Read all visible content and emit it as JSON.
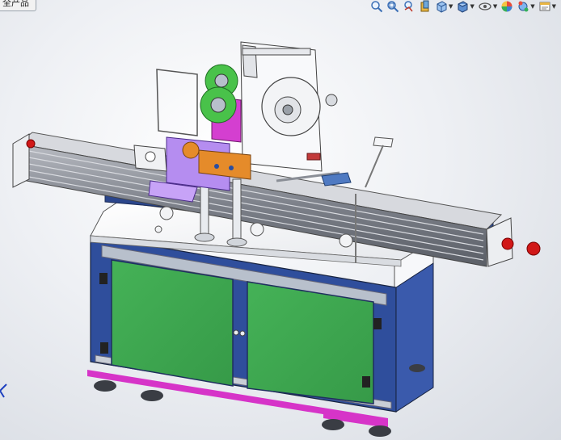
{
  "document_tab": {
    "label": "全产品"
  },
  "toolbar": {
    "items": [
      {
        "name": "zoom-to-fit-icon",
        "dropdown": false
      },
      {
        "name": "zoom-area-icon",
        "dropdown": false
      },
      {
        "name": "previous-view-icon",
        "dropdown": false
      },
      {
        "name": "section-view-icon",
        "dropdown": false
      },
      {
        "name": "view-orientation-icon",
        "dropdown": true
      },
      {
        "name": "display-style-icon",
        "dropdown": true
      },
      {
        "name": "hide-show-items-icon",
        "dropdown": true
      },
      {
        "name": "edit-appearance-icon",
        "dropdown": false
      },
      {
        "name": "apply-scene-icon",
        "dropdown": true
      },
      {
        "name": "view-settings-icon",
        "dropdown": true
      }
    ]
  },
  "colors": {
    "frame_blue": "#2f4e9c",
    "door_green": "#3ea650",
    "conveyor_gray": "#8a8e96",
    "part_purple": "#b58df0",
    "part_orange": "#e58b2a",
    "part_green": "#49c24a",
    "part_magenta": "#d43fd0",
    "stop_red": "#d11818",
    "trim_magenta": "#d634c8"
  }
}
